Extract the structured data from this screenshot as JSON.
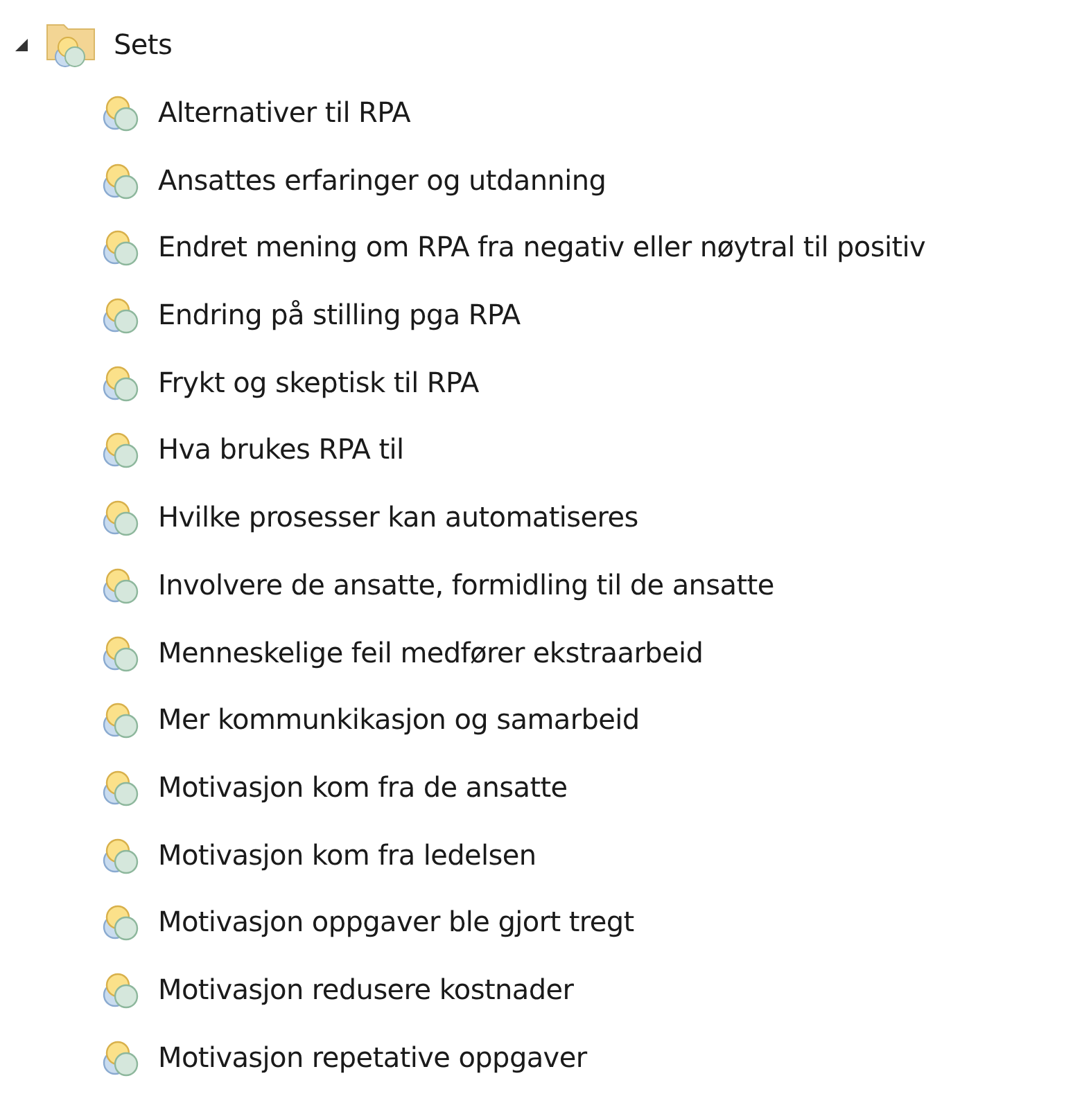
{
  "tree": {
    "label": "Sets",
    "expanded": true,
    "children": [
      {
        "label": "Alternativer til RPA"
      },
      {
        "label": "Ansattes erfaringer og utdanning"
      },
      {
        "label": "Endret mening om RPA fra negativ eller nøytral til positiv"
      },
      {
        "label": "Endring på stilling pga RPA"
      },
      {
        "label": "Frykt og skeptisk til RPA"
      },
      {
        "label": "Hva brukes RPA til"
      },
      {
        "label": "Hvilke prosesser kan automatiseres"
      },
      {
        "label": "Involvere de ansatte, formidling til de ansatte"
      },
      {
        "label": "Menneskelige feil medfører ekstraarbeid"
      },
      {
        "label": "Mer kommunkikasjon og samarbeid"
      },
      {
        "label": "Motivasjon kom fra de ansatte"
      },
      {
        "label": "Motivasjon kom fra ledelsen"
      },
      {
        "label": "Motivasjon oppgaver ble gjort tregt"
      },
      {
        "label": "Motivasjon redusere kostnader"
      },
      {
        "label": "Motivasjon repetative oppgaver"
      }
    ]
  }
}
